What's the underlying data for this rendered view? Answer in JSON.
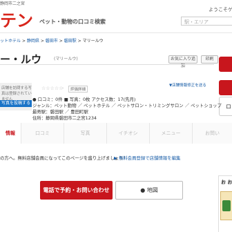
{
  "header": {
    "location": "静岡市二之宮",
    "logo": "テン",
    "tagline": "ペット・動物の口コミ検索",
    "welcome": "ようこそゲ",
    "search_placeholder": "駅・エリア"
  },
  "breadcrumb": {
    "items": [
      "ットホテル",
      "静岡県",
      "磐田市",
      "磐田駅"
    ],
    "separator": ">",
    "current": "マリールウ"
  },
  "shop": {
    "title": "ー・ルウ",
    "kana": "(マリールウ)",
    "fav_button": "お気に入り追加",
    "print_button": "印刷",
    "photo_text": "店舗を訪問する写真は登録されていません",
    "photo_button": "写真を投稿する",
    "stars": "☆☆☆☆☆",
    "score": "-",
    "rating_label": "評価詳細",
    "edit_link": "▼店舗情報修正を送る",
    "reviews": "口コミ：0件",
    "photos": "写真：0枚",
    "access": "アクセス数：17(先月)",
    "genre": "ジャンル：ペット動物 ／ ペットホテル ／ ペットサロン・トリミングサロン ／ ペットショップ",
    "station": "最寄駅：磐田駅 ／ 豊田町駅",
    "address": "住所：静岡県磐田市二之宮1234"
  },
  "side_buttons": {
    "third": "ロコ"
  },
  "tabs": [
    {
      "label": "情報",
      "active": true
    },
    {
      "label": "口コミ",
      "active": false
    },
    {
      "label": "写真",
      "active": false
    },
    {
      "label": "イチオシ",
      "active": false
    },
    {
      "label": "メニュー",
      "active": false
    },
    {
      "label": "お問い",
      "active": false
    }
  ],
  "notice": {
    "text": "の方へ。無料店舗会員になってこのページを盛り上げましょう！",
    "link": "▶ 無料会員登録で店舗情報を編集"
  },
  "actions": {
    "call": "電話で予約・お問い合わせ",
    "map": "地図"
  },
  "side_panel": {
    "title": "お お"
  },
  "colors": {
    "brand_red": "#c8161d",
    "link_blue": "#1a5ea8",
    "photo_button_blue": "#1a73c7"
  }
}
